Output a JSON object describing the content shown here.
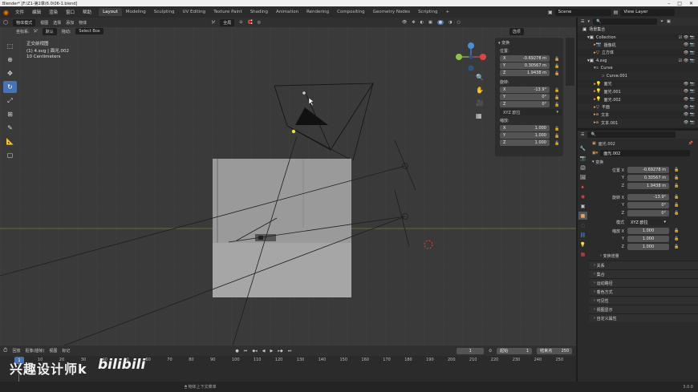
{
  "window": {
    "title": "Blender* [F:\\Z1-第2章(6.0\\06-1.blend]"
  },
  "menubar": {
    "items": [
      "文件",
      "编辑",
      "渲染",
      "窗口",
      "帮助"
    ],
    "workspaces": [
      "Layout",
      "Modeling",
      "Sculpting",
      "UV Editing",
      "Texture Paint",
      "Shading",
      "Animation",
      "Rendering",
      "Compositing",
      "Geometry Nodes",
      "Scripting"
    ],
    "active_workspace": "Layout",
    "add_workspace": "+",
    "scene": "Scene",
    "view_layer": "View Layer"
  },
  "viewport_header": {
    "mode": "物体模式",
    "menus": [
      "视图",
      "选择",
      "添加",
      "物体"
    ],
    "orientation": "全局",
    "coord_label": "坐标系:",
    "coord_value": "默认",
    "drag_label": "拖动:",
    "drag_value": "Select Box",
    "options": "选项"
  },
  "viewport_info": {
    "view_name": "正交前视图",
    "object": "(1) 4.svg | 面光.002",
    "scale": "10 Centimeters"
  },
  "npanel": {
    "section": "变换",
    "location_label": "位置:",
    "location": [
      {
        "axis": "X",
        "value": "-0.69278 m"
      },
      {
        "axis": "Y",
        "value": "0.30567 m"
      },
      {
        "axis": "Z",
        "value": "1.9438 m"
      }
    ],
    "rotation_label": "旋转:",
    "rotation": [
      {
        "axis": "X",
        "value": "-13.9°"
      },
      {
        "axis": "Y",
        "value": "0°"
      },
      {
        "axis": "Z",
        "value": "0°"
      }
    ],
    "rotation_mode": "XYZ 欧拉",
    "scale_label": "缩放:",
    "scale": [
      {
        "axis": "X",
        "value": "1.000"
      },
      {
        "axis": "Y",
        "value": "1.000"
      },
      {
        "axis": "Z",
        "value": "1.000"
      }
    ]
  },
  "outliner": {
    "root": "场景集合",
    "items": [
      {
        "name": "Collection",
        "indent": 0
      },
      {
        "name": "摄像机",
        "indent": 1
      },
      {
        "name": "立方体",
        "indent": 1
      },
      {
        "name": "4.svg",
        "indent": 0
      },
      {
        "name": "Curve",
        "indent": 1
      },
      {
        "name": "Curve.001",
        "indent": 2
      },
      {
        "name": "面光",
        "indent": 1
      },
      {
        "name": "面光.001",
        "indent": 1
      },
      {
        "name": "面光.002",
        "indent": 1
      },
      {
        "name": "平面",
        "indent": 1
      },
      {
        "name": "文本",
        "indent": 1
      },
      {
        "name": "文本.001",
        "indent": 1
      }
    ]
  },
  "properties": {
    "object_name_top": "面光.002",
    "object_name": "面光.002",
    "transform_section": "变换",
    "loc_label": [
      "位置 X",
      "Y",
      "Z"
    ],
    "loc_values": [
      "-0.69278 m",
      "0.30567 m",
      "1.9438 m"
    ],
    "rot_label": [
      "旋转 X",
      "Y",
      "Z"
    ],
    "rot_values": [
      "-13.9°",
      "0°",
      "0°"
    ],
    "mode_label": "模式",
    "mode_value": "XYZ 欧拉",
    "scale_label": [
      "缩放 X",
      "Y",
      "Z"
    ],
    "scale_values": [
      "1.000",
      "1.000",
      "1.000"
    ],
    "delta": "变换增量",
    "sections": [
      "关系",
      "集合",
      "运动路径",
      "着色方式",
      "可见性",
      "视图显示",
      "自定义属性"
    ]
  },
  "timeline": {
    "menus": [
      "回放",
      "抠像(插帧)",
      "视图",
      "标记"
    ],
    "current_frame": "1",
    "start_label": "起始",
    "start": "1",
    "end_label": "结束点",
    "end": "250",
    "ticks": [
      "0",
      "10",
      "20",
      "30",
      "40",
      "50",
      "60",
      "70",
      "80",
      "90",
      "100",
      "110",
      "120",
      "130",
      "140",
      "150",
      "160",
      "170",
      "180",
      "190",
      "200",
      "210",
      "220",
      "230",
      "240",
      "250"
    ]
  },
  "statusbar": {
    "hint": "物体上下文菜单",
    "version": "3.0.0"
  },
  "watermark": {
    "text": "兴趣设计师k",
    "logo": "bilibili"
  }
}
